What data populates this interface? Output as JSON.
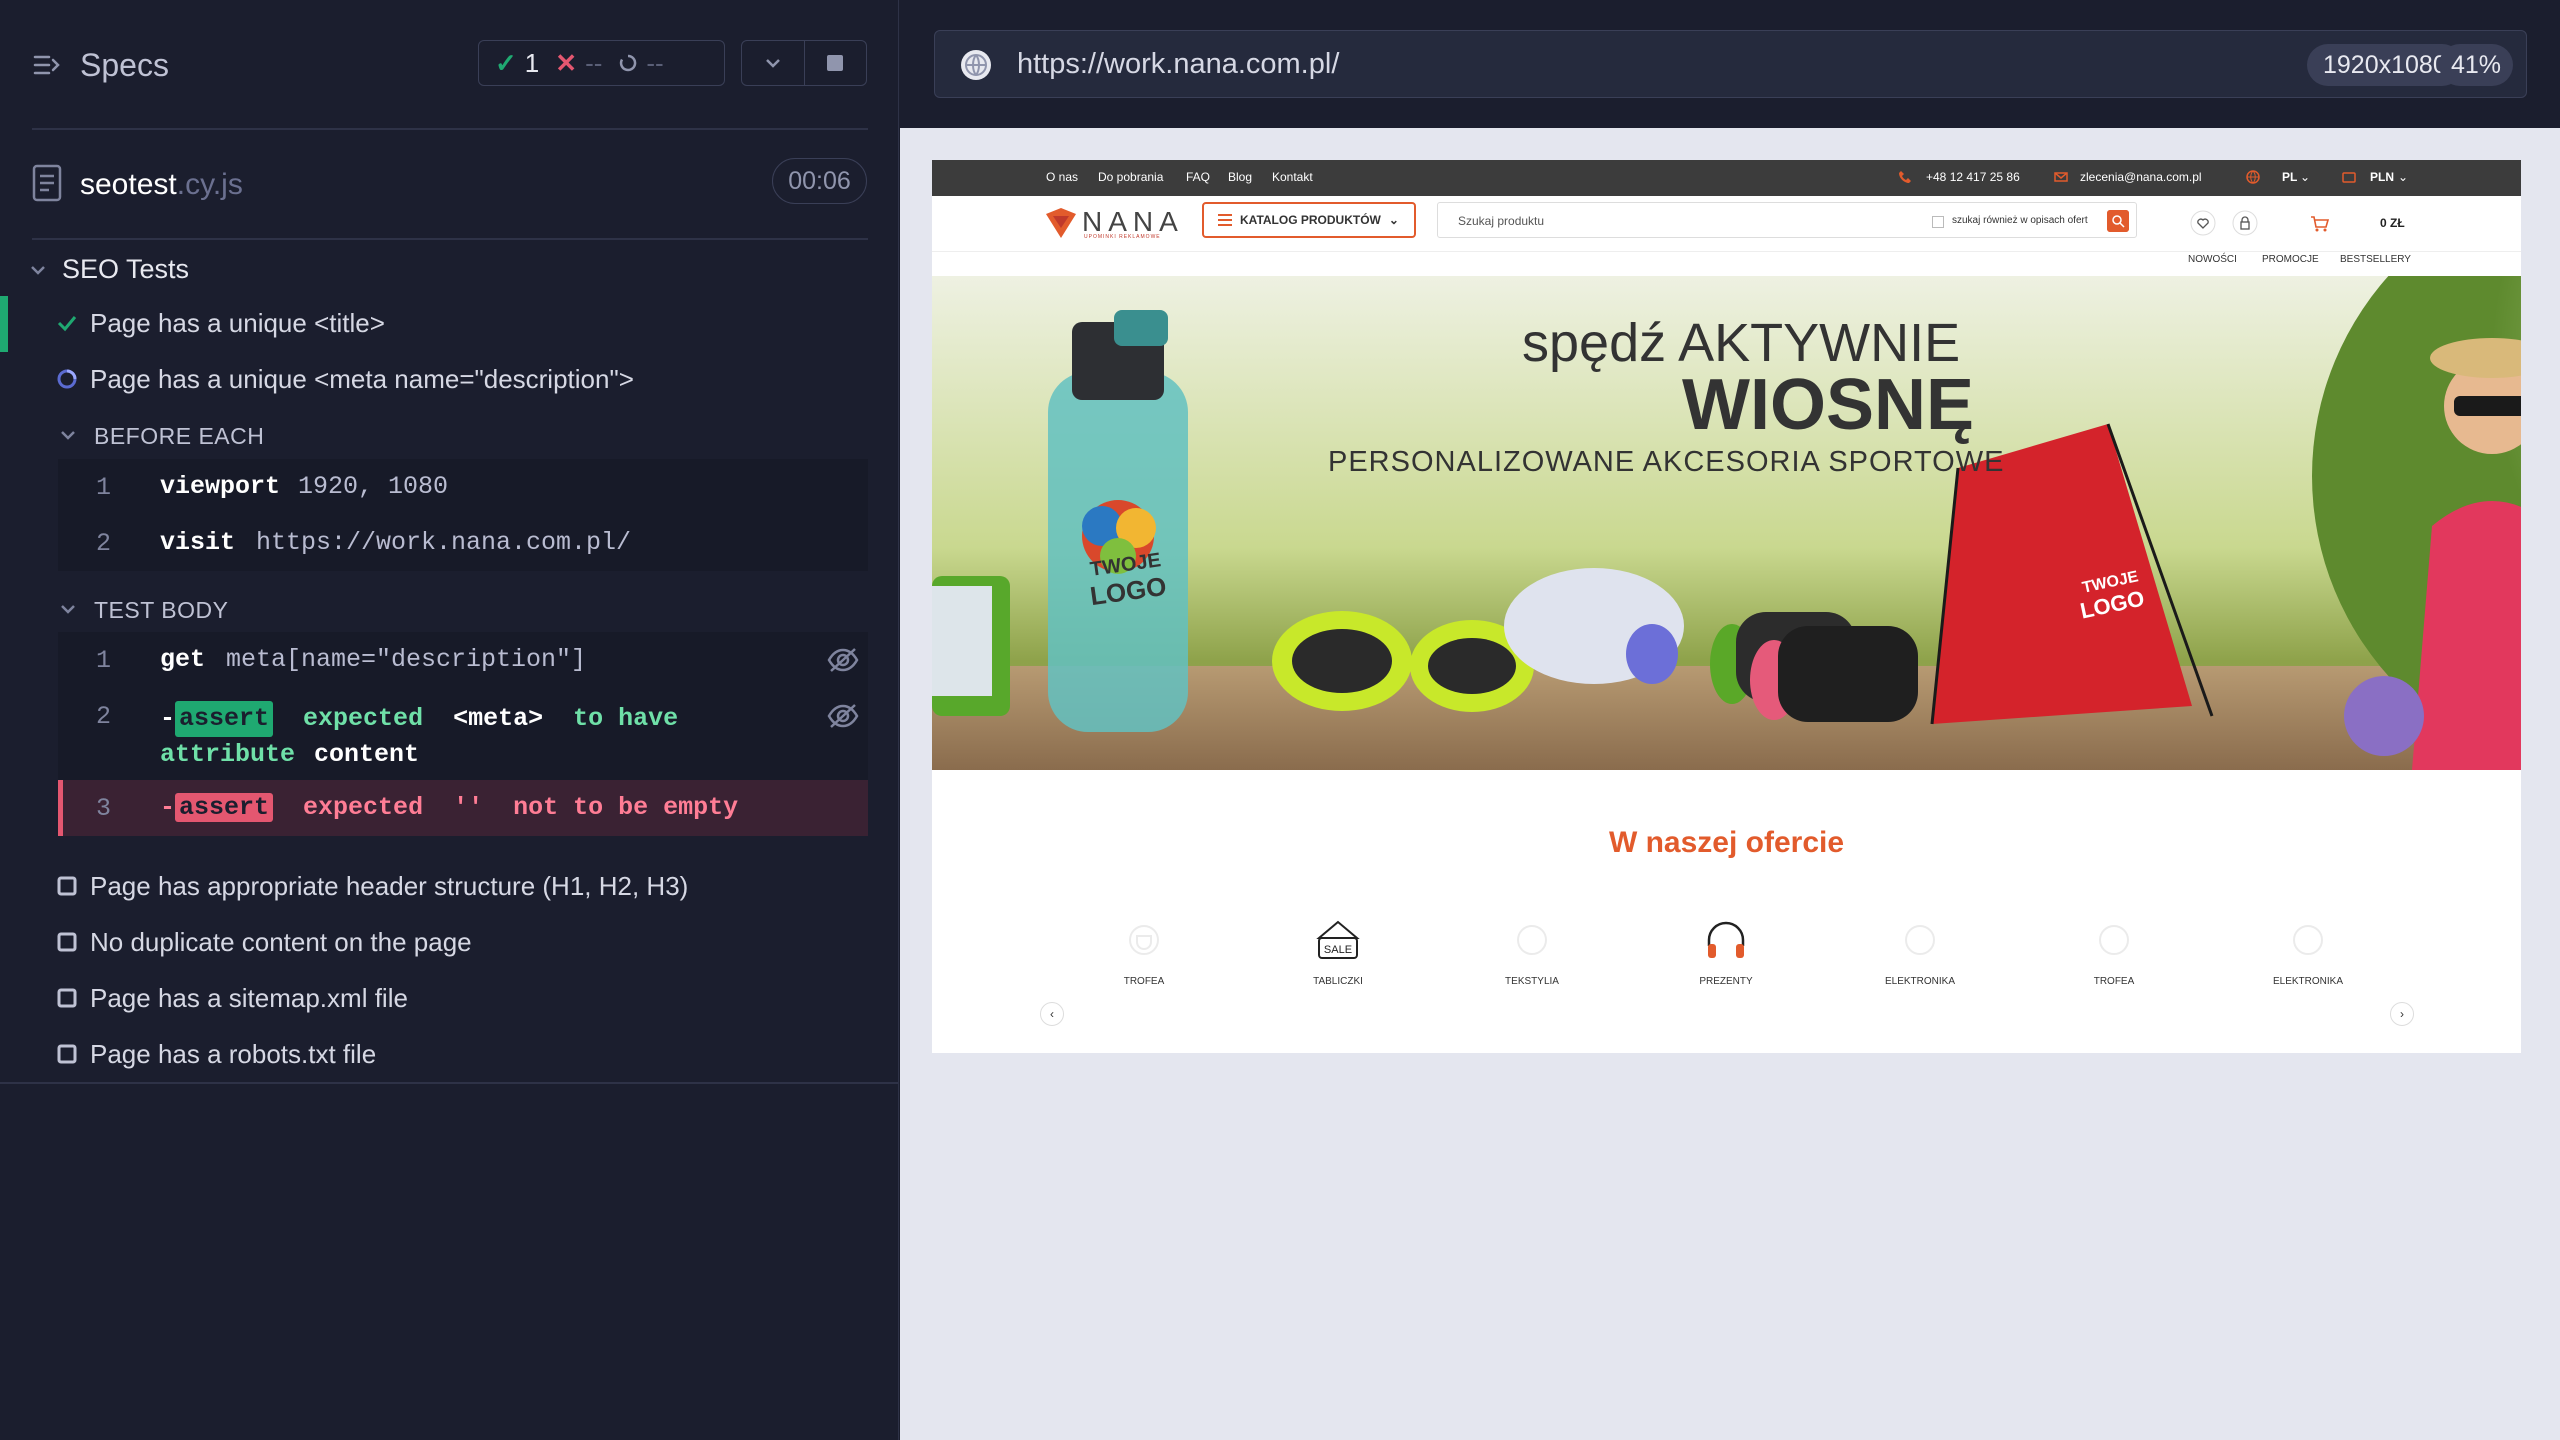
{
  "reporter": {
    "title": "Specs",
    "stats": {
      "passed": "1",
      "failed": "--",
      "pending": "--"
    },
    "file": {
      "name": "seotest",
      "ext": ".cy.js",
      "duration": "00:06"
    },
    "suite": "SEO Tests",
    "tests": [
      {
        "title": "Page has a unique <title>",
        "state": "passed"
      },
      {
        "title": "Page has a unique <meta name=\"description\">",
        "state": "running"
      },
      {
        "title": "Page has appropriate header structure (H1, H2, H3)",
        "state": "pending"
      },
      {
        "title": "No duplicate content on the page",
        "state": "pending"
      },
      {
        "title": "Page has a sitemap.xml file",
        "state": "pending"
      },
      {
        "title": "Page has a robots.txt file",
        "state": "pending"
      }
    ],
    "before_each": {
      "label": "BEFORE EACH",
      "commands": [
        {
          "num": "1",
          "name": "viewport",
          "arg": "1920, 1080"
        },
        {
          "num": "2",
          "name": "visit",
          "arg": "https://work.nana.com.pl/"
        }
      ]
    },
    "test_body": {
      "label": "TEST BODY",
      "commands": [
        {
          "num": "1",
          "name": "get",
          "arg": "meta[name=\"description\"]"
        },
        {
          "num": "2",
          "dash": "-",
          "tag": "assert",
          "p1": "expected",
          "p2": "<meta>",
          "p3": "to have attribute",
          "p4": "content"
        },
        {
          "num": "3",
          "dash": "-",
          "tag": "assert",
          "p1": "expected",
          "p2": "''",
          "p3": "not to be empty"
        }
      ]
    }
  },
  "browser": {
    "url": "https://work.nana.com.pl/",
    "viewport": "1920x1080",
    "zoom": "41%"
  },
  "site": {
    "top_links": [
      "O nas",
      "Do pobrania",
      "FAQ",
      "Blog",
      "Kontakt"
    ],
    "phone": "+48 12 417 25 86",
    "email": "zlecenia@nana.com.pl",
    "lang": "PL",
    "currency": "PLN",
    "logo": "NANA",
    "logo_sub": "UPOMINKI REKLAMOWE",
    "catalog_btn": "KATALOG PRODUKTÓW",
    "search_placeholder": "Szukaj produktu",
    "search_option": "szukaj również w opisach ofert",
    "cart_total": "0 ZŁ",
    "subnav": [
      "NOWOŚCI",
      "PROMOCJE",
      "BESTSELLERY"
    ],
    "hero": {
      "line1": "spędź AKTYWNIE",
      "line2": "WIOSNĘ",
      "line3": "PERSONALIZOWANE AKCESORIA SPORTOWE",
      "logo_text_1": "TWOJE",
      "logo_text_2": "LOGO"
    },
    "offer_title": "W naszej ofercie",
    "offers": [
      "TROFEA",
      "TABLICZKI",
      "TEKSTYLIA",
      "PREZENTY",
      "ELEKTRONIKA",
      "TROFEA",
      "ELEKTRONIKA"
    ],
    "sale_text": "SALE",
    "arrow_prev": "‹",
    "arrow_next": "›"
  }
}
